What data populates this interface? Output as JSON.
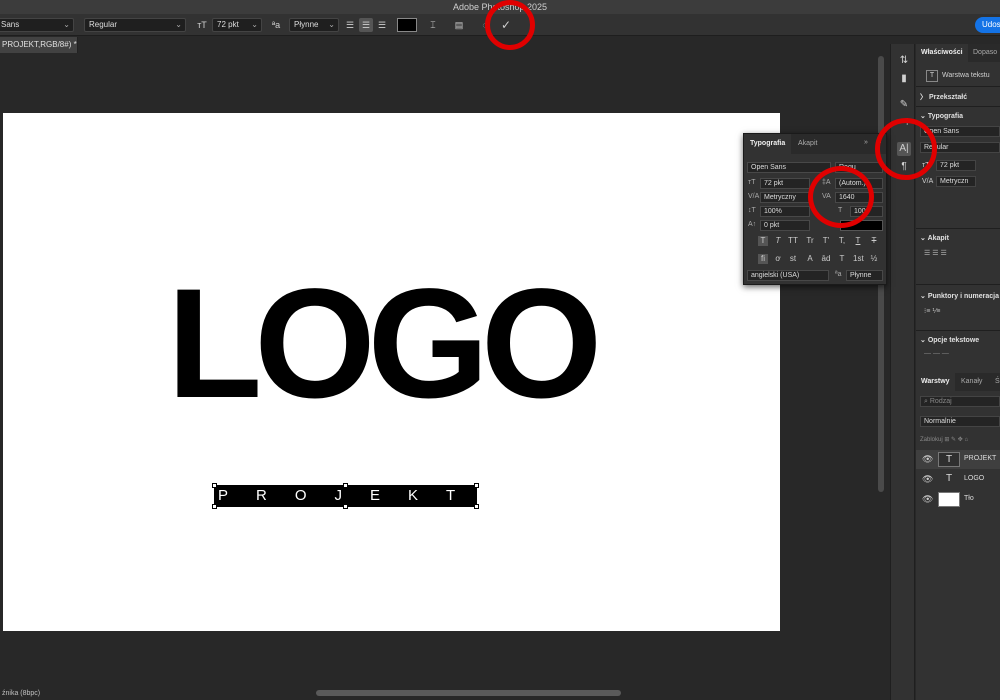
{
  "window": {
    "title": "Adobe Photoshop 2025"
  },
  "options_bar": {
    "font_family": "Sans",
    "font_style": "Regular",
    "font_size": "72 pkt",
    "antialias": "Płynne",
    "commit_icon": "✓",
    "share_label": "Udos"
  },
  "document_tab": {
    "label": "PROJEKT,RGB/8#) *"
  },
  "canvas": {
    "logo_text": "LOGO",
    "subtitle_text": "PROJEKT"
  },
  "status_bar": {
    "text": "źnika (8bpc)"
  },
  "typography_panel": {
    "tabs": [
      "Typografia",
      "Akapit"
    ],
    "font_family": "Open Sans",
    "font_style": "Regu",
    "size": "72 pkt",
    "leading": "(Autom.)",
    "kerning": "Metryczny",
    "tracking": "1640",
    "vertical_scale": "100%",
    "horizontal_scale": "100",
    "baseline_shift": "0 pkt",
    "language": "angielski (USA)",
    "antialias": "Płynne",
    "style_buttons": [
      "T",
      "T",
      "TT",
      "Tr",
      "T'",
      "T,",
      "T",
      "T"
    ],
    "opentype_buttons": [
      "fi",
      "ơ",
      "st",
      "A",
      "ād",
      "T",
      "1st",
      "½"
    ]
  },
  "properties_panel": {
    "tabs": [
      "Właściwości",
      "Dopaso"
    ],
    "layer_kind": "Warstwa tekstu",
    "transform_section": "Przekształć",
    "typography_section": "Typografia",
    "font_family": "Open Sans",
    "font_style": "Regular",
    "size": "72 pkt",
    "kerning": "Metryczn",
    "paragraph_section": "Akapit",
    "bullets_section": "Punktory i numeracja",
    "text_options_section": "Opcje tekstowe"
  },
  "layers_panel": {
    "tabs": [
      "Warstwy",
      "Kanały",
      "Ś"
    ],
    "search_placeholder": "Rodzaj",
    "blend_mode": "Normalnie",
    "lock_label": "Zablokuj",
    "layers": [
      {
        "name": "PROJEKT",
        "type": "T",
        "selected": true
      },
      {
        "name": "LOGO",
        "type": "T",
        "selected": false
      },
      {
        "name": "Tło",
        "type": "",
        "selected": false
      }
    ]
  },
  "colors": {
    "annotation_circle": "#e00000",
    "share_button": "#1473e6",
    "canvas_bg": "#ffffff",
    "workspace_bg": "#282828"
  }
}
